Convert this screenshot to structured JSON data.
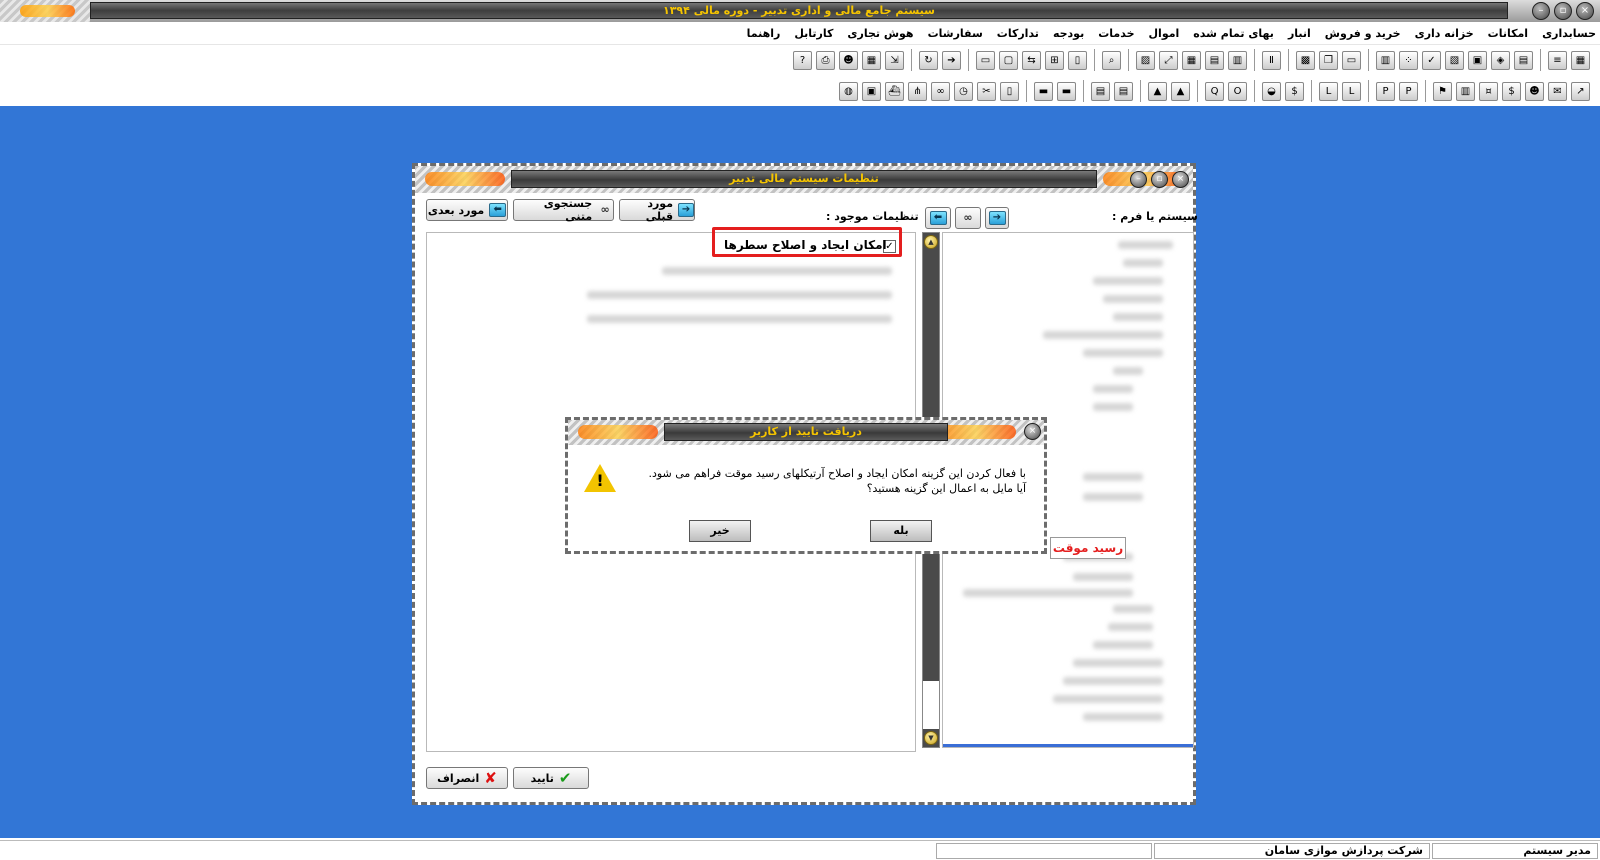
{
  "app": {
    "title": "سیستم جامع مالی و اداری تدبیر - دوره مالی ۱۳۹۴"
  },
  "menu": [
    "حسابداری",
    "امکانات",
    "خزانه داری",
    "خرید و فروش",
    "انبار",
    "بهای تمام شده",
    "اموال",
    "خدمات",
    "بودجه",
    "تدارکات",
    "سفارشات",
    "هوش تجاری",
    "کارتابل",
    "راهنما"
  ],
  "settings_window": {
    "title": "تنظیمات سیستم مالی تدبیر",
    "system_label": "سیستم یا فرم :",
    "existing_label": "تنظیمات موجود :",
    "next_button": "مورد بعدی",
    "text_search_button": "جستجوی متنی",
    "prev_button": "مورد قبلی",
    "highlighted_option": "امکان ایجاد و اصلاح سطرها",
    "selected_node": "رسید موقت",
    "confirm_button": "تایید",
    "cancel_button": "انصراف"
  },
  "dialog": {
    "title": "دریافت تایید از کاربر",
    "message_line1": "با فعال کردن این گزینه امکان ایجاد و اصلاح آرتیکلهای رسید موقت فراهم می شود.",
    "message_line2": "آیا مایل به اعمال این گزینه هستید؟",
    "yes_button": "بله",
    "no_button": "خیر"
  },
  "status": {
    "user": "مدیر سیستم",
    "company": "شرکت پردازش موازی سامان"
  },
  "colors": {
    "desktop": "#3276d6",
    "title_text": "#f5c400",
    "highlight": "#e41e1e"
  }
}
